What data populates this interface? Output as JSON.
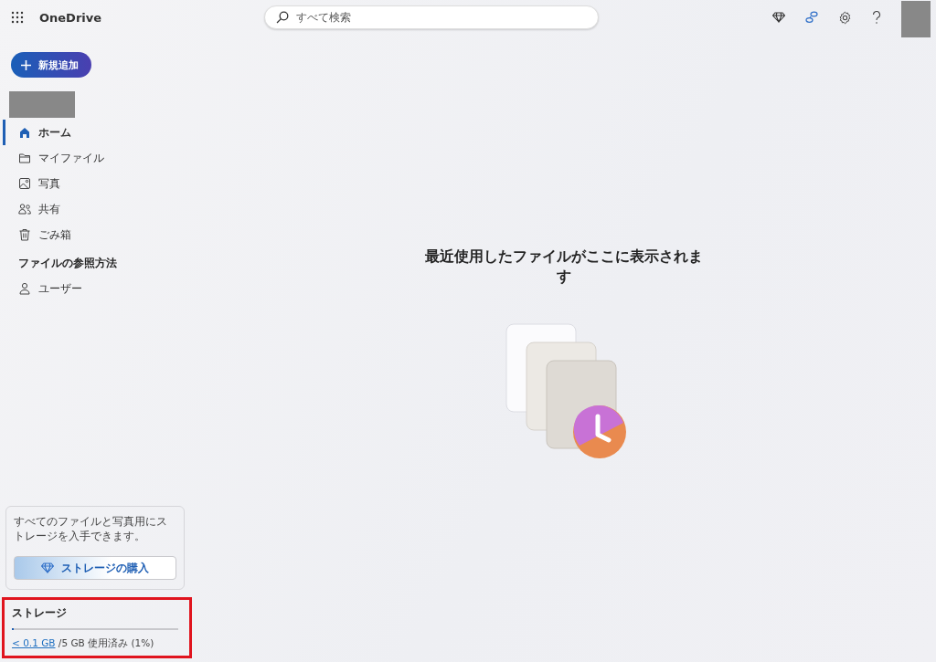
{
  "app": {
    "name": "OneDrive"
  },
  "search": {
    "placeholder": "すべて検索"
  },
  "new_button": {
    "label": "新規追加"
  },
  "nav": [
    {
      "label": "ホーム",
      "kind": "home",
      "selected": true
    },
    {
      "label": "マイファイル",
      "kind": "folder",
      "selected": false
    },
    {
      "label": "写真",
      "kind": "photo",
      "selected": false
    },
    {
      "label": "共有",
      "kind": "people",
      "selected": false
    },
    {
      "label": "ごみ箱",
      "kind": "trash",
      "selected": false
    }
  ],
  "browse": {
    "heading": "ファイルの参照方法",
    "items": [
      {
        "label": "ユーザー",
        "kind": "person",
        "selected": false
      }
    ]
  },
  "promo": {
    "text": "すべてのファイルと写真用にストレージを入手できます。",
    "button": "ストレージの購入"
  },
  "storage": {
    "title": "ストレージ",
    "level": 0.01,
    "used_link": "< 0.1 GB",
    "usage_text": "/5 GB 使用済み (1%)",
    "highlighted": true
  },
  "empty_state": {
    "message": "最近使用したファイルがここに表示されます"
  }
}
